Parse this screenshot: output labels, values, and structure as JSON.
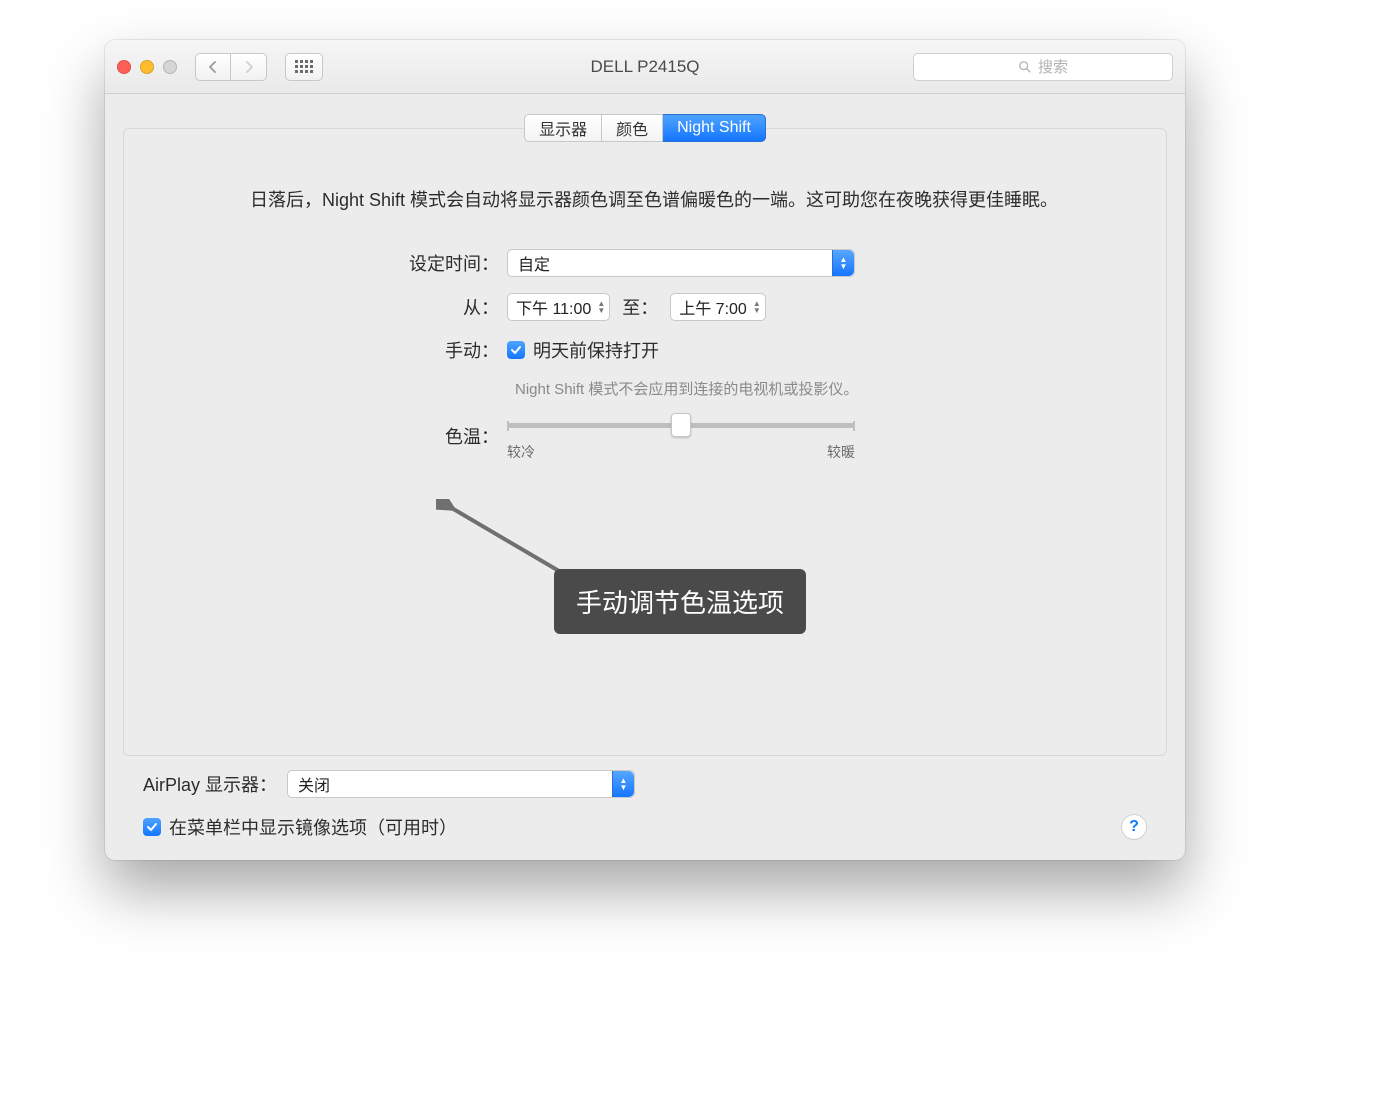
{
  "window": {
    "title": "DELL P2415Q",
    "search_placeholder": "搜索"
  },
  "tabs": {
    "display": "显示器",
    "color": "颜色",
    "night_shift": "Night Shift"
  },
  "panel": {
    "description": "日落后，Night Shift 模式会自动将显示器颜色调至色谱偏暖色的一端。这可助您在夜晚获得更佳睡眠。",
    "schedule_label": "设定时间：",
    "schedule_value": "自定",
    "from_label": "从：",
    "from_value": "下午 11:00",
    "to_label": "至：",
    "to_value": "上午  7:00",
    "manual_label": "手动：",
    "manual_checkbox": "明天前保持打开",
    "manual_hint": "Night Shift 模式不会应用到连接的电视机或投影仪。",
    "color_temp_label": "色温：",
    "slider_cold": "较冷",
    "slider_warm": "较暖",
    "slider_percent": 50
  },
  "annotation": {
    "tooltip": "手动调节色温选项"
  },
  "footer": {
    "airplay_label": "AirPlay 显示器：",
    "airplay_value": "关闭",
    "mirror_checkbox": "在菜单栏中显示镜像选项（可用时）"
  }
}
